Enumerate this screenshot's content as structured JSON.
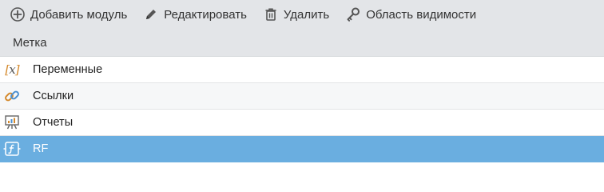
{
  "toolbar": {
    "add_label": "Добавить модуль",
    "edit_label": "Редактировать",
    "delete_label": "Удалить",
    "scope_label": "Область видимости"
  },
  "table": {
    "column_header": "Метка",
    "rows": [
      {
        "label": "Переменные",
        "icon": "variable-icon"
      },
      {
        "label": "Ссылки",
        "icon": "link-icon"
      },
      {
        "label": "Отчеты",
        "icon": "report-icon"
      },
      {
        "label": "RF",
        "icon": "function-icon",
        "selected": true
      }
    ]
  },
  "colors": {
    "toolbar_bg": "#e3e5e8",
    "selected_row_bg": "#6aaee0",
    "icon_accent": "#d4882a"
  }
}
